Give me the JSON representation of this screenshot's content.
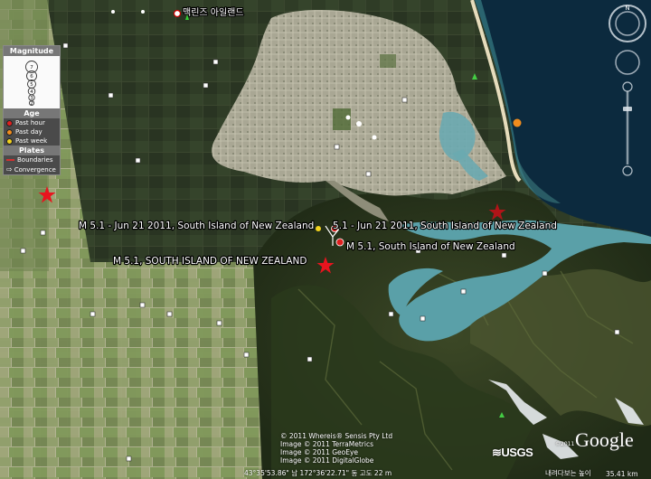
{
  "place_label": "맥린즈 아일랜드",
  "quake_labels": [
    "M 5.1 - Jun 21 2011, South Island of New Zealand",
    "5.1 - Jun 21 2011, South Island of New Zealand",
    "M 5.1, South Island of New Zealand",
    "M 5.1, SOUTH ISLAND OF NEW ZEALAND"
  ],
  "legend": {
    "magnitude_title": "Magnitude",
    "magnitude_values": [
      "7",
      "6",
      "5",
      "4",
      "3",
      "2"
    ],
    "age_title": "Age",
    "age_items": [
      {
        "label": "Past hour",
        "color": "#e02020"
      },
      {
        "label": "Past day",
        "color": "#f08c1e"
      },
      {
        "label": "Past week",
        "color": "#f2d21e"
      }
    ],
    "plates_title": "Plates",
    "plates_items": [
      {
        "label": "Boundaries",
        "icon": "boundary-line-icon",
        "color": "#d03030"
      },
      {
        "label": "Convergence",
        "icon": "convergence-arrow-icon",
        "color": "#ffffff"
      }
    ]
  },
  "credits": [
    "© 2011 Whereis® Sensis Pty Ltd",
    "Image © 2011 TerraMetrics",
    "Image © 2011 GeoEye",
    "Image © 2011 DigitalGlobe"
  ],
  "usgs_logo": "≋USGS",
  "google_logo": "Google",
  "google_copyright": "©2011",
  "status": {
    "coords": "43°35'53.86\" 남  172°36'22.71\" 동  고도  22 m",
    "streaming": "내려다보는 높이",
    "eye_alt": "35.41 km"
  },
  "colors": {
    "star_past_hour": "#e8141e",
    "star_older": "#b01418",
    "ocean": "#0c2a3e",
    "lagoon": "#5aa0a8"
  }
}
